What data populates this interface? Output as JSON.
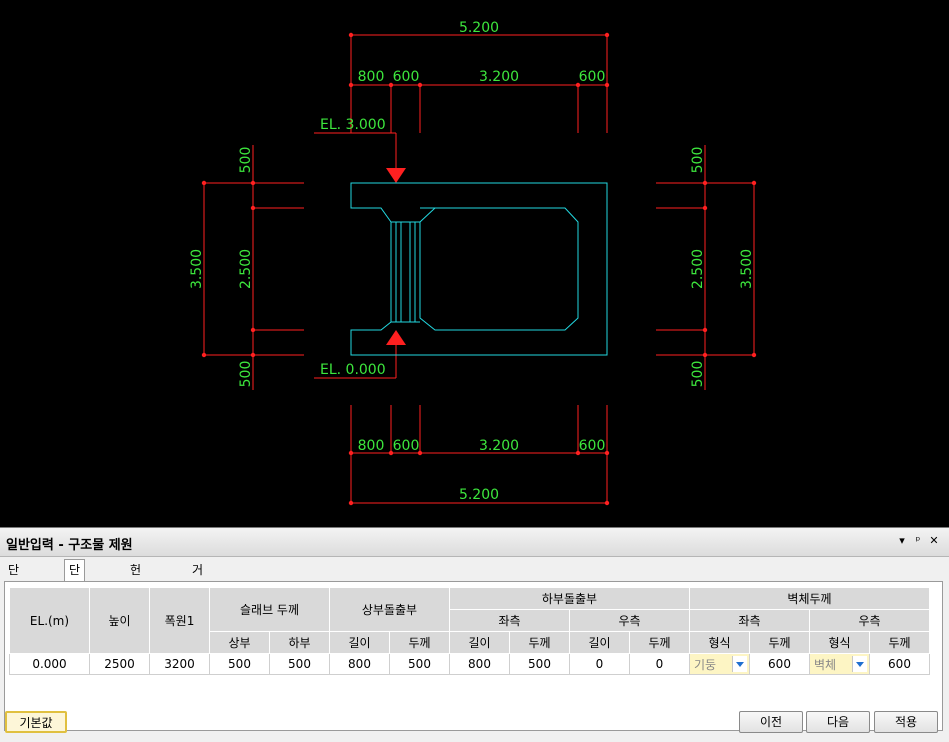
{
  "drawing": {
    "top_total": "5.200",
    "top_parts": [
      "800",
      "600",
      "3.200",
      "600"
    ],
    "bottom_total": "5.200",
    "bottom_parts": [
      "800",
      "600",
      "3.200",
      "600"
    ],
    "el_top": "EL. 3.000",
    "el_bottom": "EL. 0.000",
    "left_outer": "3.500",
    "left_parts": [
      "500",
      "2.500",
      "500"
    ],
    "right_outer": "3.500",
    "right_parts": [
      "500",
      "2.500",
      "500"
    ],
    "colors": {
      "dimension": "#ff2020",
      "text": "#3de63d",
      "structure": "#22d8e0"
    }
  },
  "panel": {
    "title": "일반입력 - 구조물 제원",
    "header_buttons": [
      "▾",
      "ᵖ",
      "✕"
    ]
  },
  "tabs": [
    "단면구성",
    "단면제원",
    "헌치제원",
    "거더제원"
  ],
  "active_tab": "단면제원",
  "table": {
    "headers": {
      "el": "EL.(m)",
      "height": "높이",
      "width1": "폭원1",
      "slab": "슬래브 두께",
      "slab_top": "상부",
      "slab_bottom": "하부",
      "upper_proj": "상부돌출부",
      "length": "길이",
      "thickness": "두께",
      "lower_proj": "하부돌출부",
      "left": "좌측",
      "right": "우측",
      "wall": "벽체두께",
      "type": "형식"
    },
    "row": {
      "el": "0.000",
      "height": "2500",
      "width1": "3200",
      "slab_top": "500",
      "slab_bottom": "500",
      "upper_len": "800",
      "upper_thk": "500",
      "lower_left_len": "800",
      "lower_left_thk": "500",
      "lower_right_len": "0",
      "lower_right_thk": "0",
      "wall_left_type": "기둥",
      "wall_left_thk": "600",
      "wall_right_type": "벽체",
      "wall_right_thk": "600"
    }
  },
  "buttons": {
    "default": "기본값",
    "prev": "이전",
    "next": "다음",
    "apply": "적용"
  }
}
